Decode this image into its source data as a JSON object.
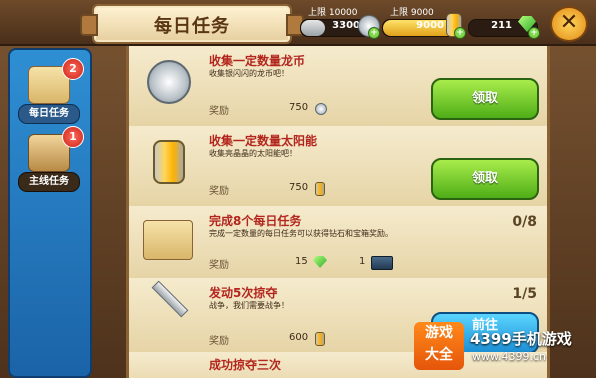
{
  "header": {
    "title": "每日任务",
    "silver": {
      "cap_label": "上限 10000",
      "value": "3300"
    },
    "sun": {
      "cap_label": "上限 9000",
      "value": "9000"
    },
    "gems": {
      "value": "211"
    },
    "close_symbol": "✕"
  },
  "sidebar": {
    "tabs": [
      {
        "label": "每日任务",
        "badge": "2",
        "active": true
      },
      {
        "label": "主线任务",
        "badge": "1",
        "active": false
      }
    ]
  },
  "tasks": [
    {
      "title": "收集一定数量龙币",
      "desc": "收集银闪闪的龙币吧！",
      "reward_label": "奖励",
      "reward_value": "750",
      "action": "领取"
    },
    {
      "title": "收集一定数量太阳能",
      "desc": "收集亮晶晶的太阳能吧！",
      "reward_label": "奖励",
      "reward_value": "750",
      "action": "领取"
    },
    {
      "title": "完成8个每日任务",
      "desc": "完成一定数量的每日任务可以获得钻石和宝箱奖励。",
      "progress": "0/8",
      "reward_label": "奖励",
      "reward_gems": "15",
      "reward_chest": "1"
    },
    {
      "title": "发动5次掠夺",
      "desc": "战争，我们需要战争！",
      "progress": "1/5",
      "reward_label": "奖励",
      "reward_value": "600",
      "action": "前往"
    },
    {
      "title": "成功掠夺三次"
    }
  ],
  "watermark": {
    "logo_line1": "游戏",
    "logo_line2": "大全",
    "name": "4399手机游戏",
    "url": "www.4399.cn"
  }
}
